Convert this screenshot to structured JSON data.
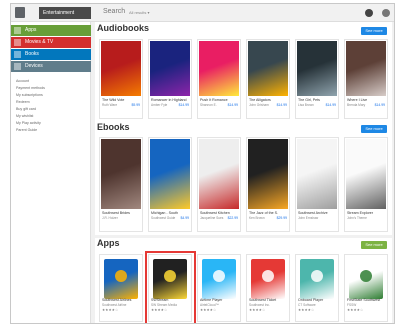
{
  "header": {
    "category_label": "Entertainment",
    "search_label": "Search",
    "search_scope": "All results ▾"
  },
  "sidebar": {
    "categories": [
      {
        "label": "Apps",
        "color": "#689f38",
        "icon": "apps-icon"
      },
      {
        "label": "Movies & TV",
        "color": "#d32f2f",
        "icon": "movies-icon"
      },
      {
        "label": "Books",
        "color": "#0277bd",
        "icon": "books-icon"
      },
      {
        "label": "Devices",
        "color": "#607d8b",
        "icon": "devices-icon"
      }
    ],
    "links": [
      "Account",
      "Payment methods",
      "My subscriptions",
      "Redeem",
      "Buy gift card",
      "My wishlist",
      "My Play activity",
      "Parent Guide"
    ]
  },
  "sections": {
    "audiobooks": {
      "title": "Audiobooks",
      "see_more": "See more",
      "items": [
        {
          "title": "The Wild Vote",
          "sub": "Ruth Ware",
          "price": "$9.99",
          "c1": "#b71c1c",
          "c2": "#f57c00"
        },
        {
          "title": "Romancer in Highland",
          "sub": "Amber Fyle",
          "price": "$14.99",
          "c1": "#1a237e",
          "c2": "#8e24aa"
        },
        {
          "title": "Push It Romance",
          "sub": "Shannon E.",
          "price": "$14.99",
          "c1": "#e91e63",
          "c2": "#ffeb3b"
        },
        {
          "title": "The Alligators",
          "sub": "John Grisham",
          "price": "$14.99",
          "c1": "#37474f",
          "c2": "#ffb300"
        },
        {
          "title": "The Girl, Pets",
          "sub": "Lisa Brown",
          "price": "$14.99",
          "c1": "#263238",
          "c2": "#90a4ae"
        },
        {
          "title": "Where I Live",
          "sub": "Brenda Mary",
          "price": "$14.99",
          "c1": "#5d4037",
          "c2": "#d7ccc8"
        }
      ]
    },
    "ebooks": {
      "title": "Ebooks",
      "see_more": "See more",
      "items": [
        {
          "title": "Southwest Brides",
          "sub": "J.R. Holzer",
          "price": "",
          "c1": "#4e342e",
          "c2": "#a1887f"
        },
        {
          "title": "Michigan - South",
          "sub": "Southwest Guide",
          "price": "$4.99",
          "c1": "#1565c0",
          "c2": "#ffca28"
        },
        {
          "title": "Southwest Kitchen",
          "sub": "Jacqueline Sues",
          "price": "$22.99",
          "c1": "#eeeeee",
          "c2": "#c62828"
        },
        {
          "title": "The Jazz of the S.",
          "sub": "Ken Brown",
          "price": "$29.99",
          "c1": "#212121",
          "c2": "#f9a825"
        },
        {
          "title": "Southwest Archive",
          "sub": "John Ernshaw",
          "price": "",
          "c1": "#f5f5f5",
          "c2": "#9e9e9e"
        },
        {
          "title": "Stream Explorer",
          "sub": "John's Theme",
          "price": "",
          "c1": "#fafafa",
          "c2": "#616161"
        }
      ]
    },
    "apps": {
      "title": "Apps",
      "see_more": "See more",
      "items": [
        {
          "title": "Southwest Airlines",
          "sub": "Southwest Airline",
          "stars": "★★★★☆",
          "c1": "#1565c0",
          "c2": "#ffb300",
          "icon": "heart-icon"
        },
        {
          "title": "SWStream",
          "sub": "SW Stream Media",
          "stars": "★★★★☆",
          "c1": "#212121",
          "c2": "#fdd835",
          "icon": "tv-icon"
        },
        {
          "title": "Airtime Player",
          "sub": "AirtelCloud™",
          "stars": "★★★★☆",
          "c1": "#29b6f6",
          "c2": "#ffffff",
          "icon": "location-pin-icon"
        },
        {
          "title": "Southwest Ticket",
          "sub": "Southwest Inc.",
          "stars": "★★★★☆",
          "c1": "#e53935",
          "c2": "#ffffff",
          "icon": "diamond-icon"
        },
        {
          "title": "Onboard Player",
          "sub": "CT Software",
          "stars": "★★★★☆",
          "c1": "#4db6ac",
          "c2": "#ffffff",
          "icon": "play-icon"
        },
        {
          "title": "FirstState Southwest",
          "sub": "FSSW",
          "stars": "★★★★☆",
          "c1": "#ffffff",
          "c2": "#2e7d32",
          "icon": "tree-icon"
        }
      ]
    }
  },
  "colors": {
    "see_more_blue": "#1e88e5",
    "see_more_green": "#7cb342",
    "highlight": "#e53935"
  }
}
